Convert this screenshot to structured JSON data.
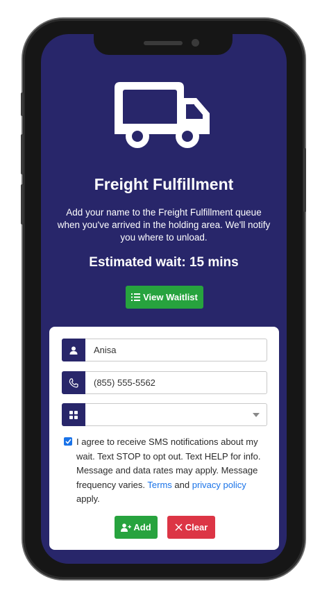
{
  "header": {
    "title": "Freight Fulfillment",
    "description": "Add your name to the Freight Fulfillment queue when you've arrived in the holding area. We'll notify you where to unload.",
    "estimated_wait": "Estimated wait: 15 mins",
    "view_waitlist_label": "View Waitlist"
  },
  "form": {
    "name_value": "Anisa",
    "phone_value": "(855) 555-5562",
    "select_value": "",
    "consent_checked": true,
    "consent_text_1": "I agree to receive SMS notifications about my wait. Text STOP to opt out. Text HELP for info. Message and data rates may apply. Message frequency varies.",
    "terms_label": "Terms",
    "and_label": "and",
    "privacy_label": "privacy policy",
    "apply_label": "apply.",
    "add_label": "Add",
    "clear_label": "Clear"
  },
  "colors": {
    "screen_bg": "#28266a",
    "primary_green": "#27a33e",
    "danger_red": "#dc3545",
    "link_blue": "#1a73e8"
  }
}
